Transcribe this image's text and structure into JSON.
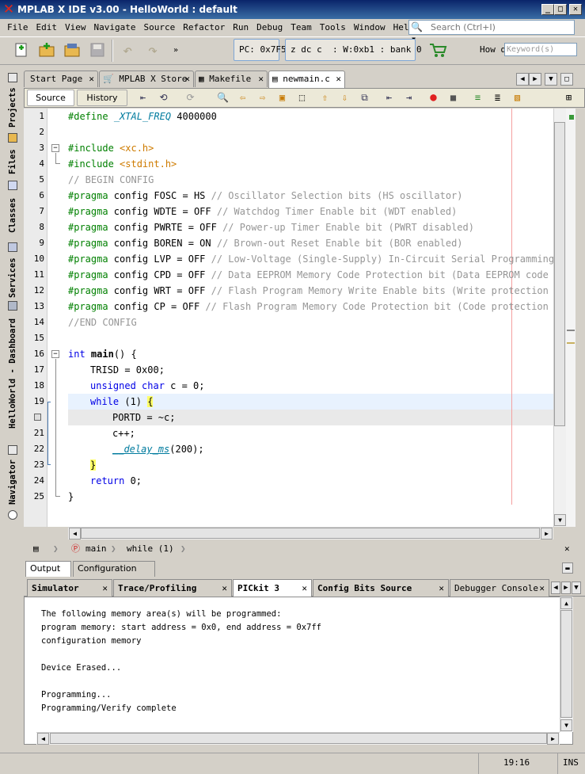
{
  "window": {
    "title": "MPLAB X IDE v3.00 - HelloWorld : default"
  },
  "menu": [
    "File",
    "Edit",
    "View",
    "Navigate",
    "Source",
    "Refactor",
    "Run",
    "Debug",
    "Team",
    "Tools",
    "Window",
    "Help"
  ],
  "search": {
    "placeholder": "Search (Ctrl+I)"
  },
  "toolbar": {
    "pc": "PC: 0x7F5",
    "status": "z dc c  : W:0xb1 : bank 0",
    "howdoi": "How do I?",
    "keyword_placeholder": "Keyword(s)"
  },
  "side_tabs": [
    "Projects",
    "Files",
    "Classes",
    "Services",
    "HelloWorld - Dashboard",
    "Navigator"
  ],
  "editor_tabs": [
    {
      "label": "Start Page"
    },
    {
      "label": "MPLAB X Store"
    },
    {
      "label": "Makefile"
    },
    {
      "label": "newmain.c",
      "active": true
    }
  ],
  "editor_toolbar": {
    "source": "Source",
    "history": "History"
  },
  "code": {
    "lines": [
      "1",
      "2",
      "3",
      "4",
      "5",
      "6",
      "7",
      "8",
      "9",
      "10",
      "11",
      "12",
      "13",
      "14",
      "15",
      "16",
      "17",
      "18",
      "19",
      "20",
      "21",
      "22",
      "23",
      "24",
      "25"
    ],
    "l1_dir": "#define",
    "l1_mac": "_XTAL_FREQ",
    "l1_val": " 4000000",
    "l3_dir": "#include",
    "l3_inc": "<xc.h>",
    "l4_dir": "#include",
    "l4_inc": "<stdint.h>",
    "l5": "// BEGIN CONFIG",
    "pragmas": [
      {
        "dir": "#pragma",
        "text": " config FOSC = HS ",
        "comment": "// Oscillator Selection bits (HS oscillator)"
      },
      {
        "dir": "#pragma",
        "text": " config WDTE = OFF ",
        "comment": "// Watchdog Timer Enable bit (WDT enabled)"
      },
      {
        "dir": "#pragma",
        "text": " config PWRTE = OFF ",
        "comment": "// Power-up Timer Enable bit (PWRT disabled)"
      },
      {
        "dir": "#pragma",
        "text": " config BOREN = ON ",
        "comment": "// Brown-out Reset Enable bit (BOR enabled)"
      },
      {
        "dir": "#pragma",
        "text": " config LVP = OFF ",
        "comment": "// Low-Voltage (Single-Supply) In-Circuit Serial Programming Er"
      },
      {
        "dir": "#pragma",
        "text": " config CPD = OFF ",
        "comment": "// Data EEPROM Memory Code Protection bit (Data EEPROM code pro"
      },
      {
        "dir": "#pragma",
        "text": " config WRT = OFF ",
        "comment": "// Flash Program Memory Write Enable bits (Write protection off"
      },
      {
        "dir": "#pragma",
        "text": " config CP = OFF ",
        "comment": "// Flash Program Memory Code Protection bit (Code protection off"
      }
    ],
    "l14": "//END CONFIG",
    "l16_kw": "int",
    "l16_fn": "main",
    "l16_rest": "() {",
    "l17": "TRISD = 0x00;",
    "l18_kw": "unsigned char",
    "l18_rest": " c = 0;",
    "l19_kw": "while",
    "l19_rest": " (1) ",
    "l19_brace": "{",
    "l20": "PORTD = ~c;",
    "l21": "c++;",
    "l22_fn": "__delay_ms",
    "l22_rest": "(200);",
    "l23_brace": "}",
    "l24_kw": "return",
    "l24_rest": " 0;",
    "l25": "}"
  },
  "breadcrumb": {
    "func": "main",
    "stmt": "while (1)"
  },
  "output": {
    "tabs": [
      {
        "label": "Output",
        "active": true
      },
      {
        "label": "Configuration Bits"
      }
    ],
    "subtabs": [
      {
        "label": "Simulator"
      },
      {
        "label": "Trace/Profiling"
      },
      {
        "label": "PICkit 3",
        "active": true
      },
      {
        "label": "Config Bits Source"
      },
      {
        "label": "Debugger Console"
      }
    ],
    "lines": [
      "The following memory area(s) will be programmed:",
      "program memory: start address = 0x0, end address = 0x7ff",
      "configuration memory",
      "",
      "Device Erased...",
      "",
      "Programming...",
      "Programming/Verify complete"
    ]
  },
  "status": {
    "position": "19:16",
    "mode": "INS"
  }
}
